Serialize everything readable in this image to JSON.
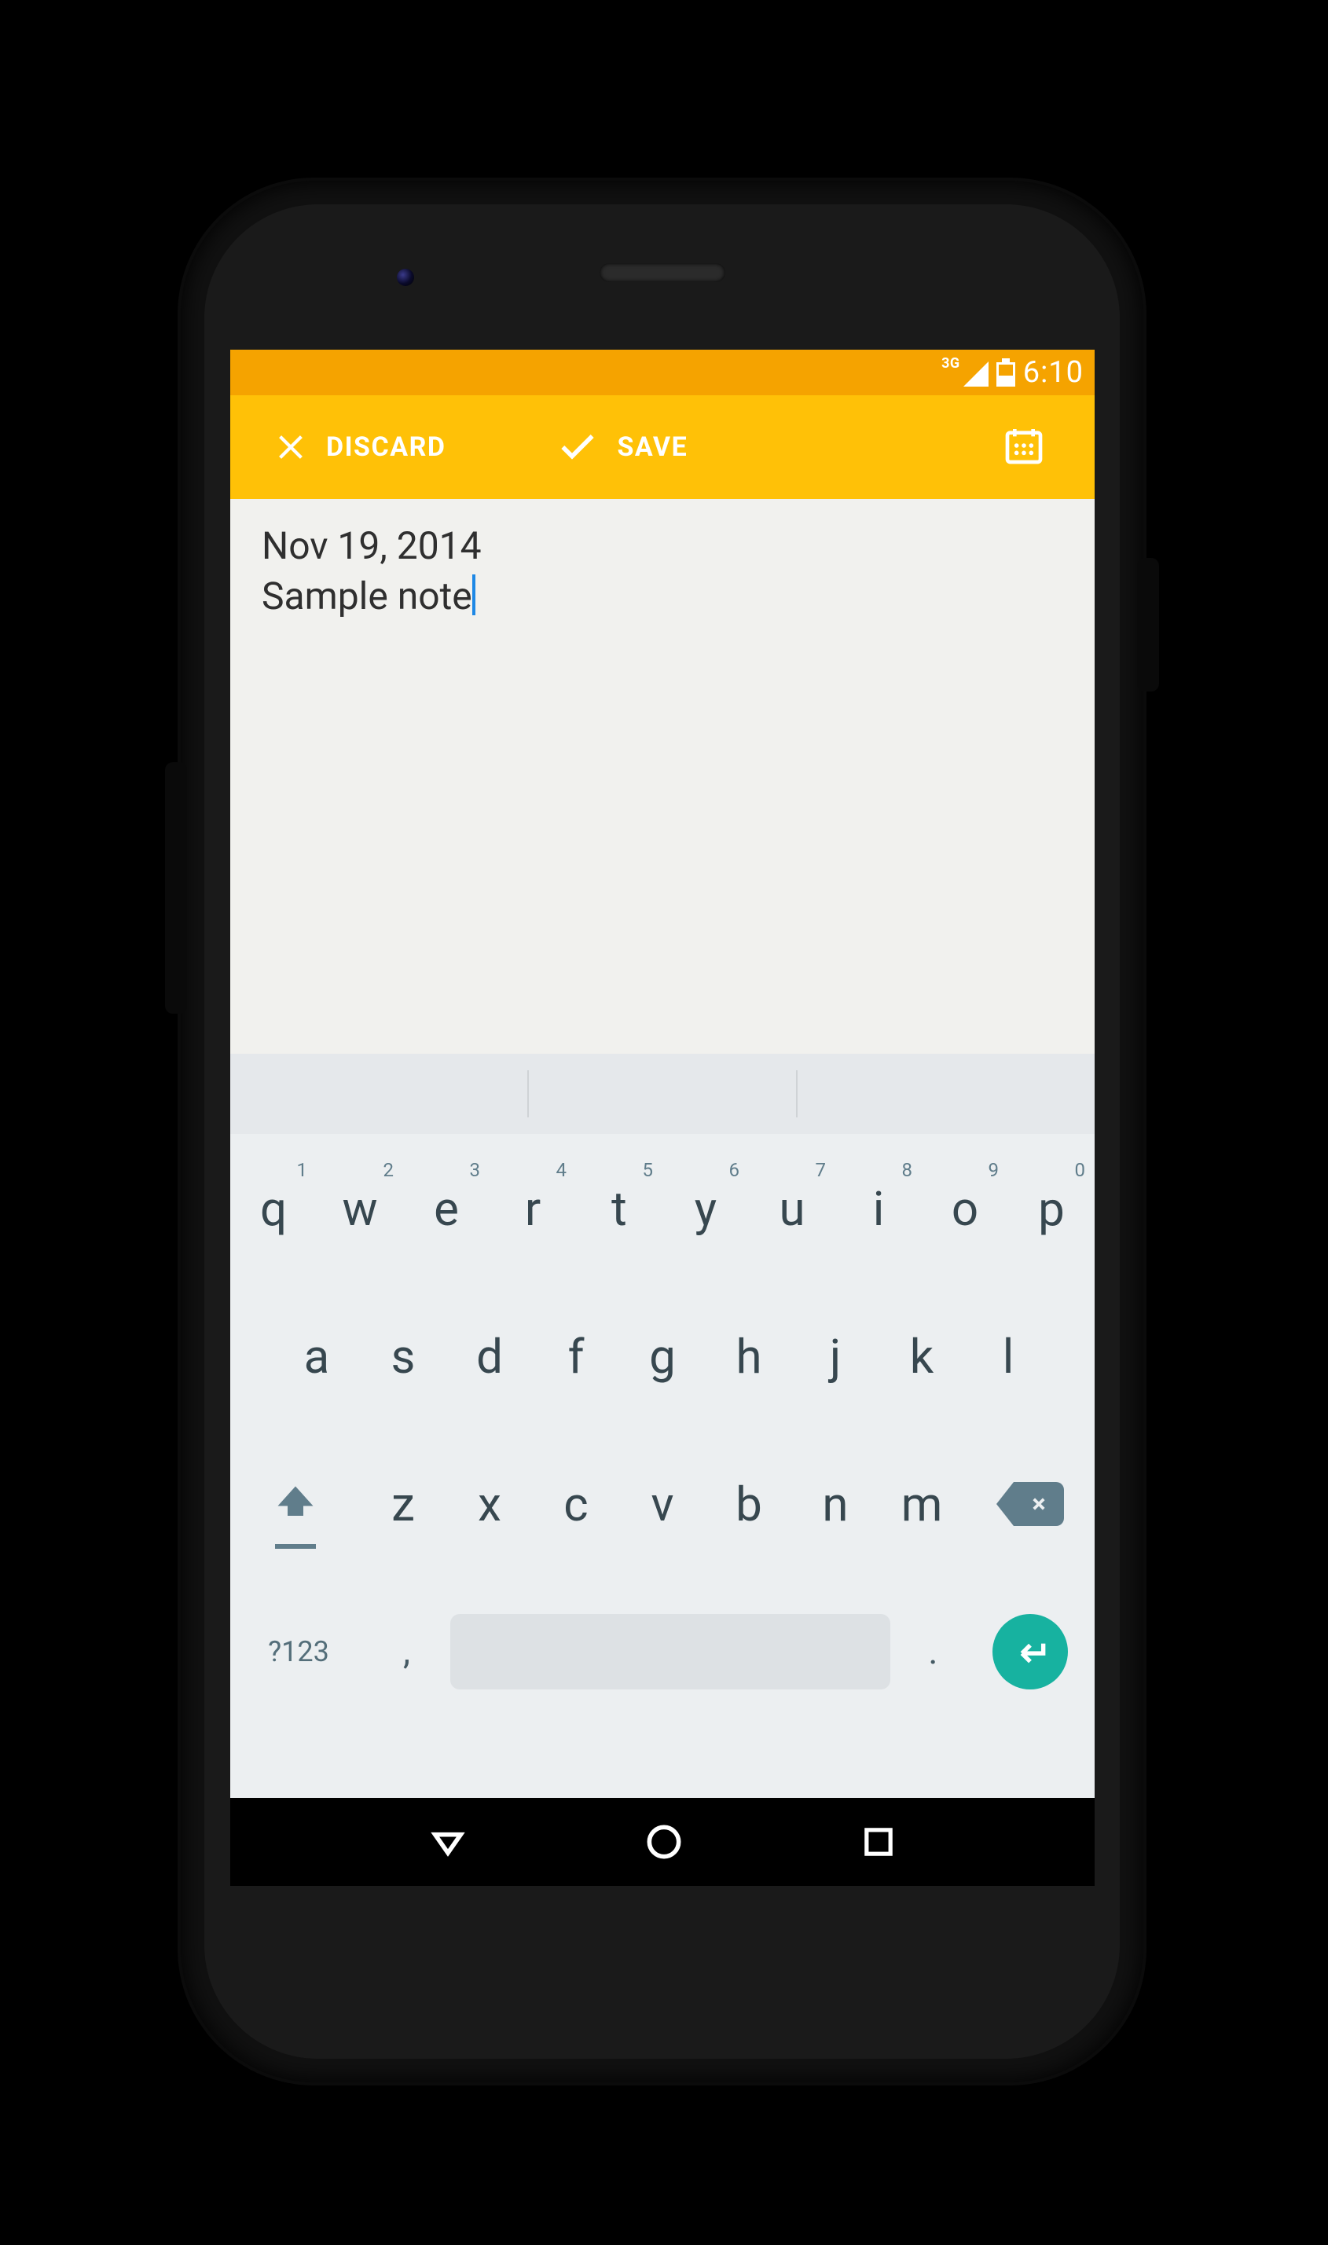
{
  "statusbar": {
    "network_type": "3G",
    "time": "6:10"
  },
  "actionbar": {
    "discard_label": "DISCARD",
    "save_label": "SAVE"
  },
  "note": {
    "date": "Nov 19, 2014",
    "text": "Sample note"
  },
  "keyboard": {
    "row1": [
      {
        "k": "q",
        "s": "1"
      },
      {
        "k": "w",
        "s": "2"
      },
      {
        "k": "e",
        "s": "3"
      },
      {
        "k": "r",
        "s": "4"
      },
      {
        "k": "t",
        "s": "5"
      },
      {
        "k": "y",
        "s": "6"
      },
      {
        "k": "u",
        "s": "7"
      },
      {
        "k": "i",
        "s": "8"
      },
      {
        "k": "o",
        "s": "9"
      },
      {
        "k": "p",
        "s": "0"
      }
    ],
    "row2": [
      "a",
      "s",
      "d",
      "f",
      "g",
      "h",
      "j",
      "k",
      "l"
    ],
    "row3": [
      "z",
      "x",
      "c",
      "v",
      "b",
      "n",
      "m"
    ],
    "sym_label": "?123",
    "comma": ",",
    "period": "."
  }
}
